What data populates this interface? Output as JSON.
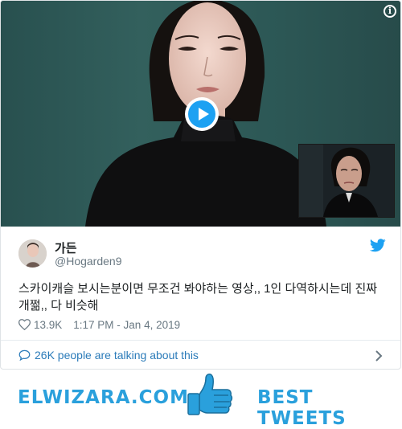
{
  "tweet": {
    "author_name": "가든",
    "author_handle": "@Hogarden9",
    "text": "스카이캐슬 보시는분이면 무조건 봐야하는 영상,, 1인 다역하시는데 진짜 개쩖,, 다 비슷해",
    "likes": "13.9K",
    "timestamp": "1:17 PM - Jan 4, 2019",
    "talking_label": "26K people are talking about this"
  },
  "media": {
    "info_glyph": "i",
    "play_icon": "play-icon"
  },
  "banner": {
    "left_text": "ELWIZARA.COM",
    "right_text": "BEST TWEETS"
  },
  "colors": {
    "accent": "#1da1f2",
    "link": "#2b7bb9",
    "banner": "#2aa0dc",
    "muted": "#697882"
  }
}
